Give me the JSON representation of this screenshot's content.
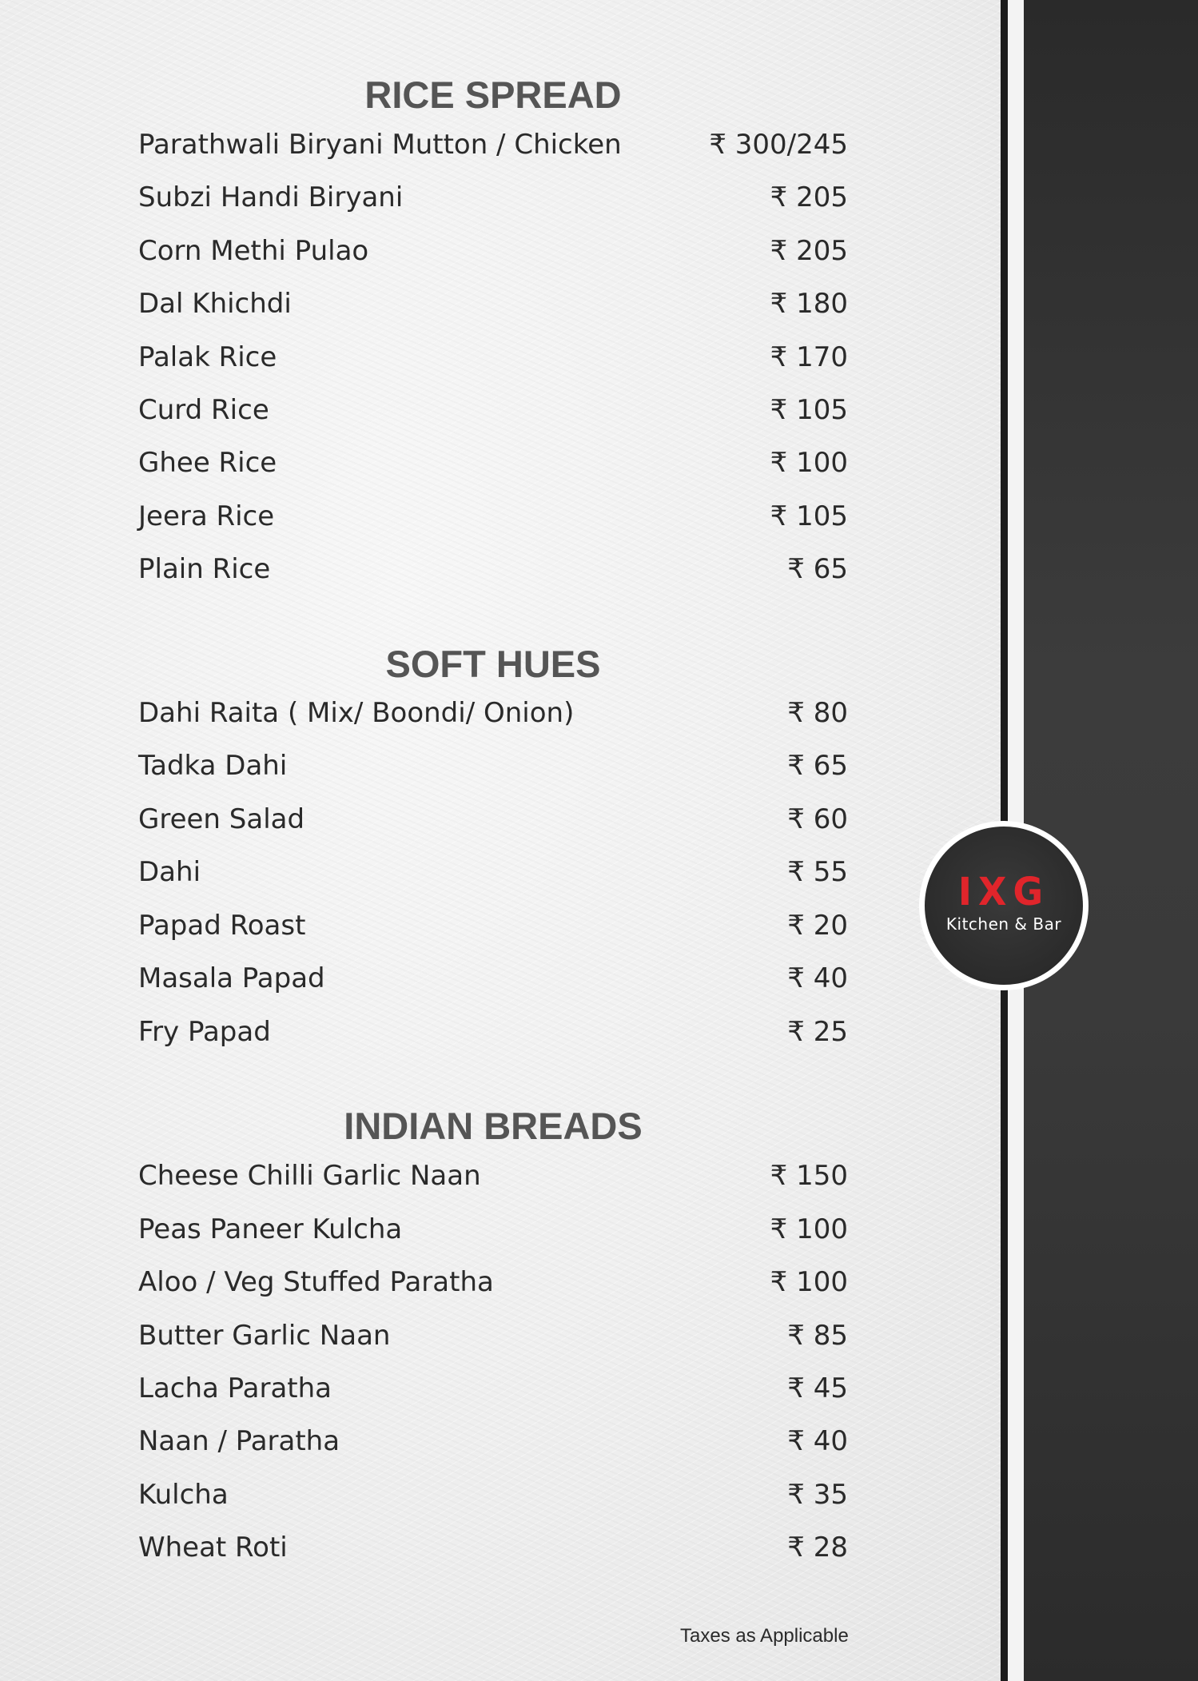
{
  "sections": [
    {
      "title": "RICE SPREAD",
      "items": [
        {
          "name": "Parathwali Biryani Mutton / Chicken",
          "price": "₹ 300/245"
        },
        {
          "name": "Subzi Handi Biryani",
          "price": "₹ 205"
        },
        {
          "name": "Corn Methi Pulao",
          "price": "₹ 205"
        },
        {
          "name": "Dal Khichdi",
          "price": "₹ 180"
        },
        {
          "name": "Palak Rice",
          "price": "₹ 170"
        },
        {
          "name": "Curd Rice",
          "price": "₹ 105"
        },
        {
          "name": "Ghee Rice",
          "price": "₹ 100"
        },
        {
          "name": "Jeera Rice",
          "price": "₹ 105"
        },
        {
          "name": "Plain Rice",
          "price": "₹ 65"
        }
      ]
    },
    {
      "title": "SOFT HUES",
      "items": [
        {
          "name": "Dahi Raita ( Mix/ Boondi/ Onion)",
          "price": "₹ 80"
        },
        {
          "name": "Tadka Dahi",
          "price": "₹ 65"
        },
        {
          "name": "Green Salad",
          "price": "₹ 60"
        },
        {
          "name": "Dahi",
          "price": "₹ 55"
        },
        {
          "name": "Papad Roast",
          "price": "₹ 20"
        },
        {
          "name": "Masala Papad",
          "price": "₹ 40"
        },
        {
          "name": "Fry Papad",
          "price": "₹ 25"
        }
      ]
    },
    {
      "title": "INDIAN BREADS",
      "items": [
        {
          "name": "Cheese Chilli Garlic Naan",
          "price": "₹ 150"
        },
        {
          "name": "Peas Paneer Kulcha",
          "price": "₹ 100"
        },
        {
          "name": "Aloo / Veg Stuffed Paratha",
          "price": "₹ 100"
        },
        {
          "name": "Butter Garlic Naan",
          "price": "₹ 85"
        },
        {
          "name": "Lacha Paratha",
          "price": "₹ 45"
        },
        {
          "name": "Naan / Paratha",
          "price": "₹ 40"
        },
        {
          "name": "Kulcha",
          "price": "₹ 35"
        },
        {
          "name": "Wheat Roti",
          "price": "₹ 28"
        }
      ]
    }
  ],
  "footer": {
    "note": "Taxes as Applicable"
  },
  "logo": {
    "mark": "IXG",
    "subtitle": "Kitchen & Bar",
    "mark_color": "#e0252b"
  },
  "colors": {
    "band": "#333333",
    "title": "#555555",
    "text": "#2a2a2a",
    "paper": "#efefef"
  }
}
